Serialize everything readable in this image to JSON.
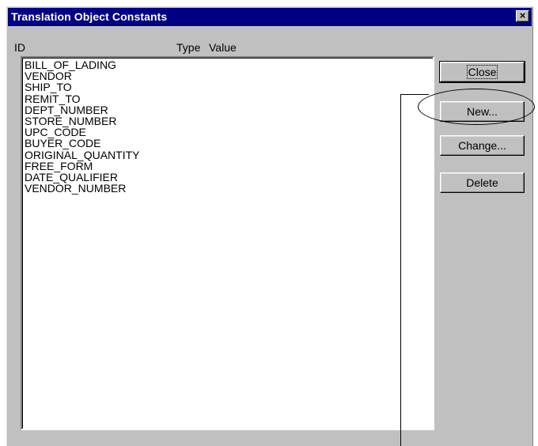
{
  "window": {
    "title": "Translation Object Constants",
    "close_glyph": "×"
  },
  "columns": {
    "id": "ID",
    "type": "Type",
    "value": "Value"
  },
  "list": {
    "items": [
      "BILL_OF_LADING",
      "VENDOR",
      "SHIP_TO",
      "REMIT_TO",
      "DEPT_NUMBER",
      "STORE_NUMBER",
      "UPC_CODE",
      "BUYER_CODE",
      "ORIGINAL_QUANTITY",
      "FREE_FORM",
      "DATE_QUALIFIER",
      "VENDOR_NUMBER"
    ]
  },
  "buttons": {
    "close": "Close",
    "new": "New...",
    "change": "Change...",
    "delete": "Delete"
  },
  "colors": {
    "titlebar": "#000080",
    "dialog_face": "#c0c0c0",
    "list_background": "#ffffff"
  }
}
